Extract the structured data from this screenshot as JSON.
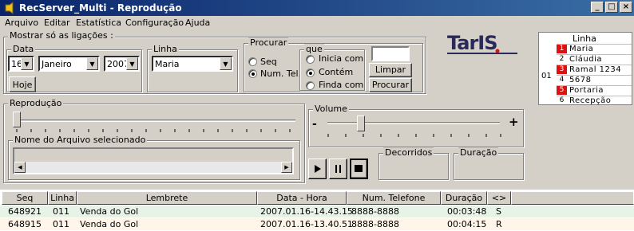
{
  "window": {
    "title": "RecServer_Multi - Reprodução"
  },
  "menu": {
    "items": [
      "Arquivo",
      "Editar",
      "Estatística",
      "Configuração",
      "Ajuda"
    ]
  },
  "filters": {
    "group_label": "Mostrar só as ligações :",
    "data_label": "Data",
    "day": "16",
    "month": "Janeiro",
    "year": "2007",
    "hoje_button": "Hoje",
    "linha_label": "Linha",
    "linha_value": "Maria"
  },
  "search": {
    "group_label": "Procurar",
    "seq_label": "Seq",
    "num_tel_label": "Num. Tel.",
    "que_label": "que",
    "inicia_com": "Inicia com",
    "contem": "Contém",
    "finda_com": "Finda com",
    "query_value": "",
    "limpar_button": "Limpar",
    "procurar_button": "Procurar"
  },
  "logo": {
    "text": "TarIS"
  },
  "lines_panel": {
    "header": "Linha",
    "group_number": "01",
    "items": [
      {
        "num": "1",
        "label": "Maria",
        "status": "active"
      },
      {
        "num": "2",
        "label": "Cláudia",
        "status": "idle"
      },
      {
        "num": "3",
        "label": "Ramal 1234",
        "status": "active"
      },
      {
        "num": "4",
        "label": "5678",
        "status": "idle"
      },
      {
        "num": "5",
        "label": "Portaria",
        "status": "active"
      },
      {
        "num": "6",
        "label": "Recepção",
        "status": "idle"
      }
    ],
    "active_color": "#e01010"
  },
  "playback": {
    "group_label": "Reprodução",
    "position": 0,
    "file_group_label": "Nome do Arquivo selecionado",
    "file_name": ""
  },
  "volume": {
    "group_label": "Volume",
    "minus": "-",
    "plus": "+",
    "level": 0.2
  },
  "timers": {
    "decorridos_label": "Decorridos",
    "duracao_label": "Duração"
  },
  "table": {
    "columns": [
      "Seq",
      "Linha",
      "Lembrete",
      "Data - Hora",
      "Num. Telefone",
      "Duração",
      "<>"
    ],
    "rows": [
      {
        "seq": "648921",
        "linha": "011",
        "lembrete": "Venda do Gol",
        "data_hora": "2007.01.16-14.43.15",
        "telefone": "8888-8888",
        "duracao": "00:03:48",
        "dir": "S"
      },
      {
        "seq": "648915",
        "linha": "011",
        "lembrete": "Venda do Gol",
        "data_hora": "2007.01.16-13.40.51",
        "telefone": "8888-8888",
        "duracao": "00:04:15",
        "dir": "R"
      }
    ]
  }
}
